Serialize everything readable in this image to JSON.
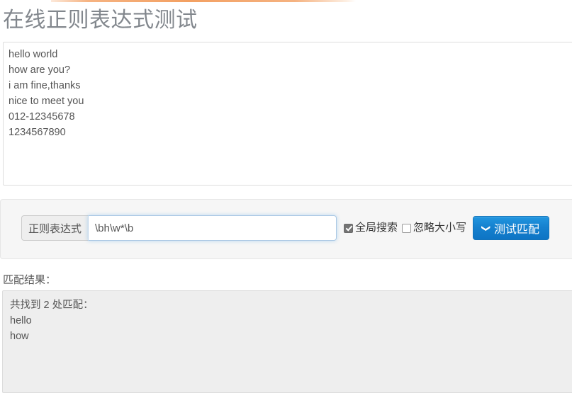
{
  "progress": {
    "visible": true,
    "color": "#f3a062",
    "percent": 62
  },
  "page": {
    "title": "在线正则表达式测试",
    "title_color": "#82878d"
  },
  "source": {
    "name": "source-text",
    "value": "hello world\nhow are you?\ni am fine,thanks\nnice to meet you\n012-12345678\n1234567890",
    "lines": [
      "hello world",
      "how are you?",
      "i am fine,thanks",
      "nice to meet you",
      "012-12345678",
      "1234567890"
    ],
    "placeholder": ""
  },
  "form": {
    "addon_label": "正则表达式",
    "regex_value": "\\bh\\w*\\b",
    "regex_placeholder": "",
    "focused": true,
    "options": [
      {
        "label": "全局搜索",
        "checked": true,
        "flag": "g"
      },
      {
        "label": "忽略大小写",
        "checked": false,
        "flag": "i"
      }
    ],
    "submit": {
      "label": "测试匹配",
      "icon": "chevron-down-icon",
      "color": "#1581cf"
    }
  },
  "results": {
    "label": "匹配结果：",
    "summary": "共找到 2 处匹配：",
    "count": 2,
    "matches": [
      "hello",
      "how"
    ]
  }
}
